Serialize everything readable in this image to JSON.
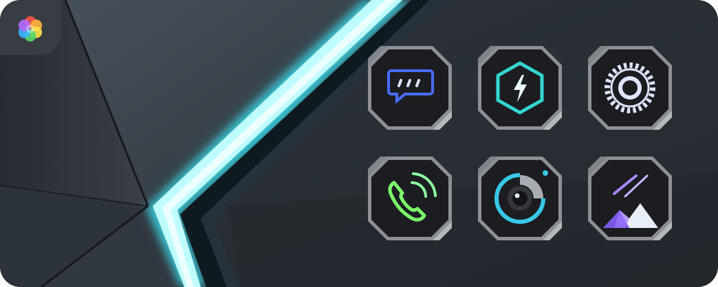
{
  "app": {
    "icon": "theme-app-logo-icon"
  },
  "wallpaper": {
    "accent": "#46f0ff",
    "base": "#2a3038"
  },
  "icon_pack": [
    {
      "icon": "message-icon",
      "color": "#4a6cff"
    },
    {
      "icon": "lightning-hexagon-icon",
      "color": "#33d6d0"
    },
    {
      "icon": "settings-gear-icon",
      "color": "#dfe6ff"
    },
    {
      "icon": "phone-icon",
      "color": "#7dff6a"
    },
    {
      "icon": "camera-icon",
      "color": "#39c8e8"
    },
    {
      "icon": "gallery-icon",
      "color": "#a78bff"
    }
  ]
}
